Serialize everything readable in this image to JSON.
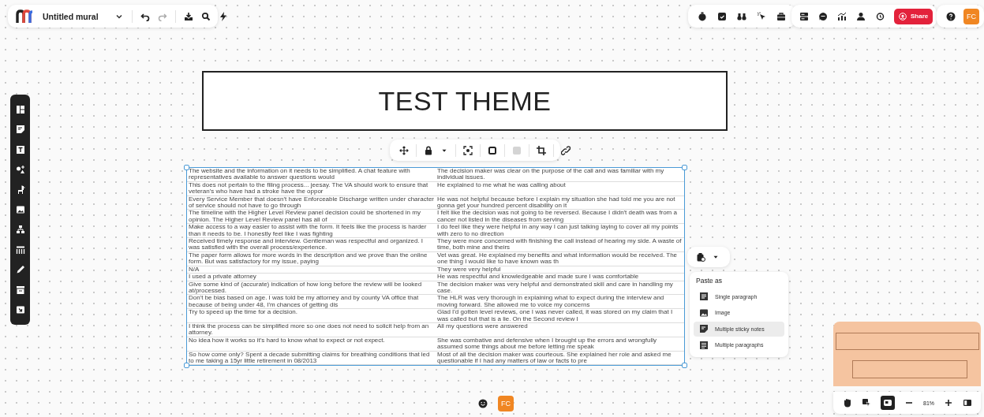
{
  "app_bar": {
    "title": "Untitled mural"
  },
  "top_right": {
    "share_label": "Share",
    "avatar_initials": "FC"
  },
  "canvas": {
    "title_text": "TEST THEME",
    "table": {
      "rows": [
        [
          "The website and the information on it needs to be simplified. A chat feature with representatives available to answer questions would",
          "The decision maker was clear on the purpose of the call and was familiar with my individual issues."
        ],
        [
          "This does not pertain to the filing process... jeesay. The VA should work to ensure that veteran's who have had a stroke have the oppor",
          "He explained to me what he was calling about"
        ],
        [
          "Every Service Member that doesn't have Enforceable Discharge written under character of service should not have to go through",
          "He was not helpful because before I explain my situation she had told me you are not gonna get your hundred percent disability on it"
        ],
        [
          "The timeline with the Higher Level Review panel decision could be shortened in my opinion. The Higher Level Review panel has all of",
          "I felt like the decision was not going to be reversed. Because I didn't death was from a cancer not listed in the diseases from serving"
        ],
        [
          "Make access to a way easier to assist with the form. It feels like the process is harder than it needs to be. I honestly feel like I was fighting",
          "I do feel like they were helpful in any way I can just talking laying to cover all my points with zero to no direction"
        ],
        [
          "Received timely response and interview. Gentleman was respectful and organized. I was satisfied with the overall process/experience.",
          "They were more concerned with finishing the call instead of hearing my side. A waste of time, both mine and theirs"
        ],
        [
          "The paper form allows for more words in the description and we prove than the online form. But was satisfactory for my issue, paying",
          "Vet was great. He explained my benefits and what information would be received. The one thing I would like to have known was th"
        ],
        [
          "N/A",
          "They were very helpful"
        ],
        [
          "I used a private attorney",
          "He was respectful and knowledgeable and made sure I was comfortable"
        ],
        [
          "Give some kind of (accurate) indication of how long before the review will be looked at/processed.",
          "The decision maker was very helpful and demonstrated skill and care in handling my case."
        ],
        [
          "Don't be bias based on age. I was told be my attorney and by county VA office that because of being under 48, I'm chances of getting dis",
          "The HLR was very thorough in explaining what to expect during the interview and moving forward. She allowed me to voice my concerns"
        ],
        [
          "Try to speed up the time for a decision.",
          "Glad I'd gotten level reviews, one I was never called, it was stored on my claim that I was called but that is a lie. On the Second review I"
        ],
        [
          "I think the process can be simplified more so one does not need to solicit help from an attorney.",
          "All my questions were answered"
        ],
        [
          "No idea how it works so it's hard to know what to expect or not expect.",
          "She was combative and defensive when I brought up the errors and wrongfully assumed some things about me before letting me speak"
        ],
        [
          "So how come only? Spent a decade submitting claims for breathing conditions that led to me taking a 15yr little retirement in 08/2013",
          "Most of all the decision maker was courteous. She explained her role and asked me questionable if I had any matters of law or facts to pre"
        ]
      ]
    }
  },
  "paste_menu": {
    "heading": "Paste as",
    "items": [
      {
        "label": "Single paragraph",
        "kind": "paragraph",
        "selected": false
      },
      {
        "label": "Image",
        "kind": "image",
        "selected": false
      },
      {
        "label": "Multiple sticky notes",
        "kind": "sticky",
        "selected": true
      },
      {
        "label": "Multiple paragraphs",
        "kind": "paragraphs",
        "selected": false
      }
    ]
  },
  "presence": {
    "avatar_initials": "FC"
  },
  "zoom": {
    "reading": "81%"
  }
}
